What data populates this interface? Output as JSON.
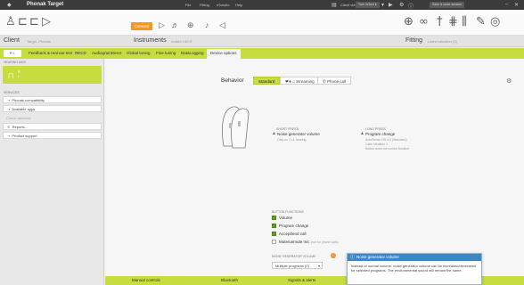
{
  "titlebar": {
    "app_name": "Phonak Target",
    "menus": [
      "File",
      "Fitting",
      "eSolutio",
      "Help"
    ],
    "client_view": "Client view",
    "status_select": "Turn in/turn it",
    "save_close": "Save & close session"
  },
  "toolbar": {
    "connect_label": "Connect"
  },
  "inforow": {
    "client_label": "Client",
    "client_name": "Target, Phonak",
    "instruments_label": "Instruments",
    "instruments_name": "Audéo L90-R",
    "fitting_label": "Fitting",
    "fitting_sub": "Latest situation (3)"
  },
  "tabs": {
    "first": "R  L",
    "items": [
      "Feedback & real ear test",
      "RECD",
      "AudiogramDirect",
      "Global tuning",
      "Fine tuning",
      "DataLogging",
      "Device options"
    ],
    "active_index": 6
  },
  "sidebar": {
    "hearing_aids_header": "HEARING AIDS",
    "hearing_aid_text": "R\nL",
    "services_header": "SERVICES",
    "items": [
      "Phonak compatibility",
      "Available apps"
    ],
    "check_warranty": "Check warranty",
    "reports": "Reports...",
    "product_support": "Product support"
  },
  "main": {
    "behavior_label": "Behavior",
    "segments": [
      "Standard",
      "Streaming",
      "Phone call"
    ],
    "short_press": {
      "header": "SHORT PRESS",
      "value": "Noise generator volume",
      "sub": "Only on 1 L1 hearing"
    },
    "long_press": {
      "header": "LONG PRESS",
      "value": "Program change",
      "sub1": "AutoSense OS 4.0 (Standard)",
      "sub2": "Calm situation 1",
      "sub3": "Button does not control function"
    },
    "button_functions_header": "BUTTON FUNCTIONS",
    "functions": [
      {
        "label": "Volume",
        "checked": true
      },
      {
        "label": "Program change",
        "checked": true
      },
      {
        "label": "Accept/end call",
        "checked": true
      },
      {
        "label": "Mute/unmute mic",
        "note": "(not for phone calls)",
        "checked": false
      }
    ],
    "noise_header": "NOISE GENERATOR VOLUME",
    "noise_dropdown": "Multiple programs (2)"
  },
  "tooltip": {
    "title": "Noise generator volume",
    "body": "Instead of normal volume, noise generator volume can be increased/decreased for selected programs. The environmental sound will remain the same."
  },
  "bottom_tabs": [
    "Manual controls",
    "Bluetooth",
    "Signals & alerts"
  ]
}
